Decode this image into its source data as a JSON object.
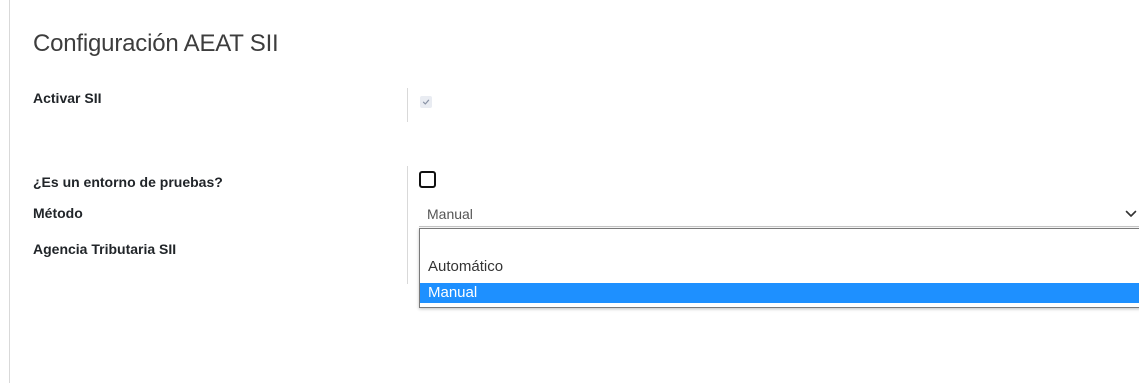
{
  "section": {
    "title": "Configuración AEAT SII"
  },
  "fields": {
    "activar_sii": {
      "label": "Activar SII",
      "checked": true
    },
    "entorno_pruebas": {
      "label": "¿Es un entorno de pruebas?",
      "checked": false
    },
    "metodo": {
      "label": "Método",
      "value": "Manual",
      "options": [
        "",
        "Automático",
        "Manual"
      ],
      "selected_option": "Manual"
    },
    "agencia": {
      "label": "Agencia Tributaria SII"
    }
  },
  "icons": {
    "select_arrow": "chevron-down-icon",
    "check": "check-icon"
  },
  "colors": {
    "selected_option_bg": "#1e90ff",
    "selected_option_text": "#ffffff"
  }
}
